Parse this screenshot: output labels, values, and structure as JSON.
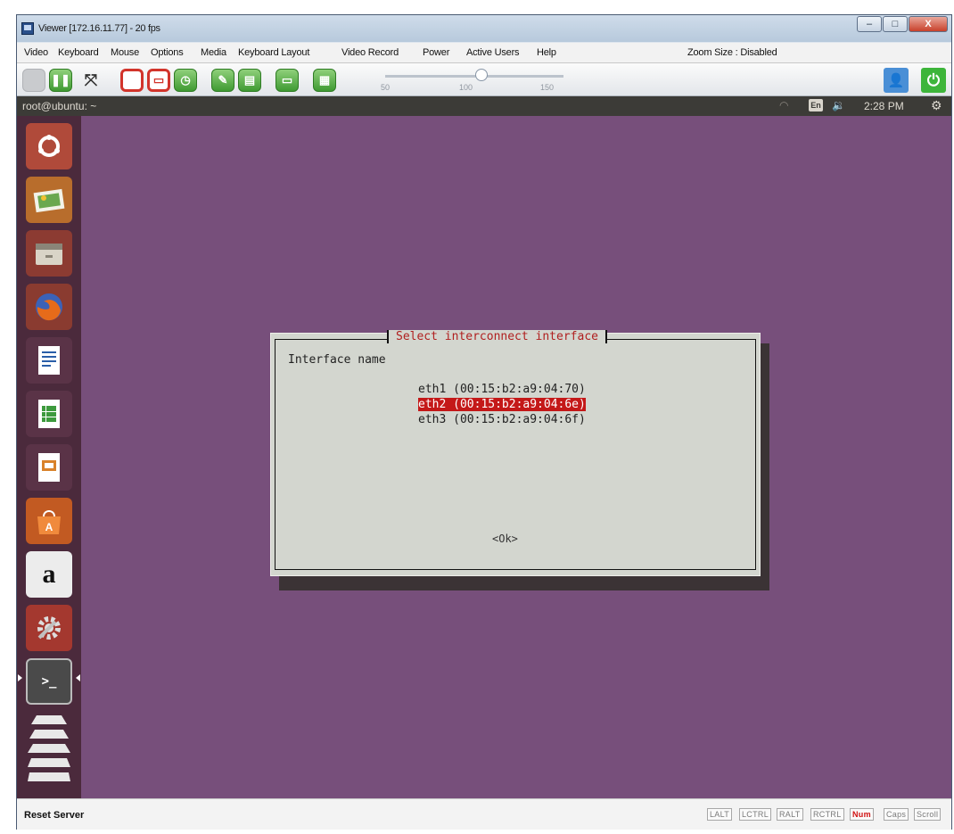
{
  "window": {
    "title": "Viewer [172.16.11.77] - 20 fps"
  },
  "window_controls": {
    "minimize": "–",
    "maximize": "□",
    "close": "X"
  },
  "menu": [
    "Video",
    "Keyboard",
    "Mouse",
    "Options",
    "Media",
    "Keyboard Layout",
    "Video Record",
    "Power",
    "Active Users",
    "Help"
  ],
  "zoom": {
    "label": "Zoom Size : Disabled"
  },
  "toolbar": {
    "icons": [
      "grey-button-icon",
      "pause-icon",
      "fullscreen-icon",
      "record-icon",
      "save-icon",
      "screenshot-icon",
      "edit-icon",
      "keyboard-icon",
      "monitor-icon",
      "hid-icon",
      "user-icon",
      "power-icon"
    ],
    "slider_ticks": [
      "50",
      "100",
      "150"
    ],
    "slider_value": 100
  },
  "ubuntu_panel": {
    "title": "root@ubuntu: ~",
    "keyboard_indicator": "En",
    "time": "2:28 PM",
    "icons": [
      "wifi-icon",
      "volume-icon",
      "settings-gear-icon"
    ]
  },
  "launcher": {
    "items": [
      "ubuntu-dash-icon",
      "image-viewer-icon",
      "file-manager-icon",
      "firefox-icon",
      "writer-icon",
      "calc-icon",
      "impress-icon",
      "software-center-icon",
      "amazon-icon",
      "system-settings-icon",
      "terminal-icon",
      "workspaces-icon"
    ],
    "amazon_glyph": "a",
    "terminal_glyph": ">_"
  },
  "dialog": {
    "title": "Select interconnect interface",
    "label": "Interface name",
    "interfaces": [
      "eth1 (00:15:b2:a9:04:70)",
      "eth2 (00:15:b2:a9:04:6e)",
      "eth3 (00:15:b2:a9:04:6f)"
    ],
    "selected_index": 1,
    "ok_label": "<Ok>"
  },
  "statusbar": {
    "text": "Reset Server",
    "indicators": [
      "LALT",
      "LCTRL",
      "RALT",
      "RCTRL",
      "Num",
      "Caps",
      "Scroll"
    ],
    "active": [
      "Num"
    ]
  },
  "colors": {
    "desktop": "#774f7b",
    "launcher": "#4b2a3c",
    "selection": "#c41818",
    "dialog_title": "#b02020"
  }
}
